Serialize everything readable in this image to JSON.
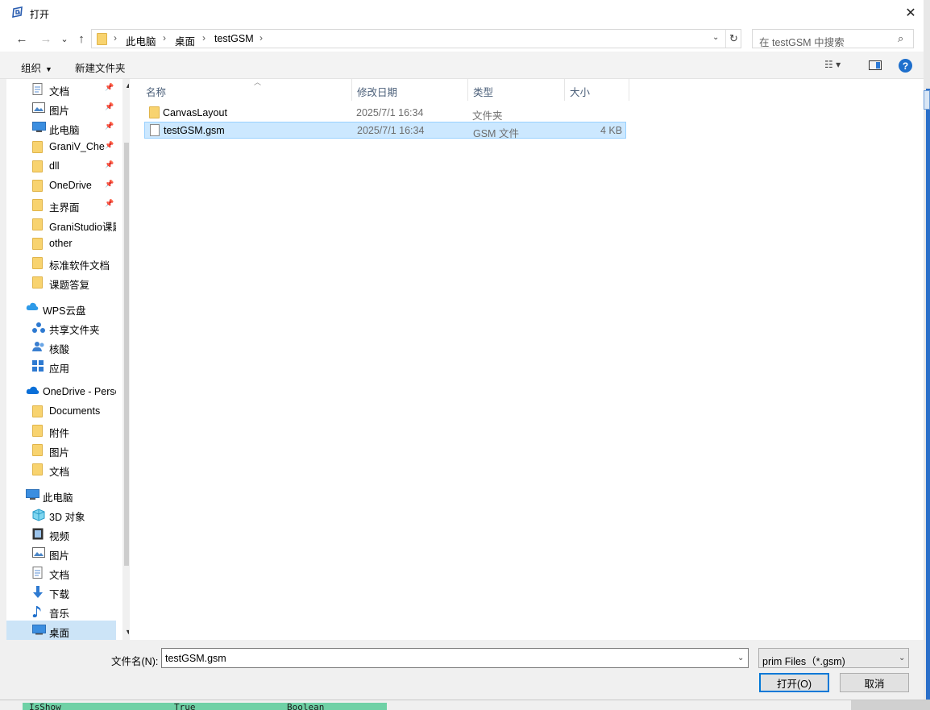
{
  "window": {
    "title": "打开",
    "close_glyph": "✕"
  },
  "nav": {
    "back_glyph": "←",
    "forward_glyph": "→",
    "recent_glyph": "⌄",
    "up_glyph": "↑",
    "breadcrumb": [
      "此电脑",
      "桌面",
      "testGSM"
    ],
    "search_placeholder": "在 testGSM 中搜索"
  },
  "toolbar": {
    "organize": "组织",
    "new_folder": "新建文件夹"
  },
  "sidebar": {
    "items": [
      {
        "label": "文档",
        "icon": "document-icon",
        "pinned": true
      },
      {
        "label": "图片",
        "icon": "pictures-icon",
        "pinned": true
      },
      {
        "label": "此电脑",
        "icon": "computer-icon",
        "pinned": true
      },
      {
        "label": "GraniV_Che",
        "icon": "folder-icon",
        "pinned": true
      },
      {
        "label": "dll",
        "icon": "folder-icon",
        "pinned": true
      },
      {
        "label": "OneDrive",
        "icon": "folder-icon",
        "pinned": true
      },
      {
        "label": "主界面",
        "icon": "folder-icon",
        "pinned": true
      },
      {
        "label": "GraniStudio课题",
        "icon": "folder-icon",
        "pinned": false
      },
      {
        "label": "other",
        "icon": "folder-icon",
        "pinned": false
      },
      {
        "label": "标准软件文档",
        "icon": "folder-icon",
        "pinned": false
      },
      {
        "label": "课题答复",
        "icon": "folder-icon",
        "pinned": false
      },
      {
        "label": "WPS云盘",
        "icon": "cloud-icon",
        "pinned": false
      },
      {
        "label": "共享文件夹",
        "icon": "share-icon",
        "pinned": false
      },
      {
        "label": "核酸",
        "icon": "people-icon",
        "pinned": false
      },
      {
        "label": "应用",
        "icon": "apps-icon",
        "pinned": false
      },
      {
        "label": "OneDrive - Personal",
        "icon": "onedrive-icon",
        "pinned": false
      },
      {
        "label": "Documents",
        "icon": "folder-icon",
        "pinned": false
      },
      {
        "label": "附件",
        "icon": "folder-icon",
        "pinned": false
      },
      {
        "label": "图片",
        "icon": "folder-icon",
        "pinned": false
      },
      {
        "label": "文档",
        "icon": "folder-icon",
        "pinned": false
      },
      {
        "label": "此电脑",
        "icon": "computer-icon",
        "pinned": false
      },
      {
        "label": "3D 对象",
        "icon": "3d-objects-icon",
        "pinned": false
      },
      {
        "label": "视频",
        "icon": "video-icon",
        "pinned": false
      },
      {
        "label": "图片",
        "icon": "pictures-icon",
        "pinned": false
      },
      {
        "label": "文档",
        "icon": "document-icon",
        "pinned": false
      },
      {
        "label": "下载",
        "icon": "download-icon",
        "pinned": false
      },
      {
        "label": "音乐",
        "icon": "music-icon",
        "pinned": false
      },
      {
        "label": "桌面",
        "icon": "desktop-icon",
        "pinned": false,
        "selected": true
      }
    ]
  },
  "filelist": {
    "columns": [
      "名称",
      "修改日期",
      "类型",
      "大小"
    ],
    "rows": [
      {
        "name": "CanvasLayout",
        "date": "2025/7/1 16:34",
        "type": "文件夹",
        "size": "",
        "icon": "folder-icon"
      },
      {
        "name": "testGSM.gsm",
        "date": "2025/7/1 16:34",
        "type": "GSM 文件",
        "size": "4 KB",
        "icon": "file-icon",
        "selected": true
      }
    ]
  },
  "bottom": {
    "filename_label": "文件名(N):",
    "filename_value": "testGSM.gsm",
    "filter_value": "prim Files（*.gsm)",
    "open_button": "打开(O)",
    "cancel_button": "取消"
  },
  "background": {
    "cells": [
      "IsShow",
      "True",
      "Boolean"
    ]
  },
  "colors": {
    "accent": "#0078d7",
    "selection": "#cce8ff",
    "folder": "#f8d36f"
  }
}
